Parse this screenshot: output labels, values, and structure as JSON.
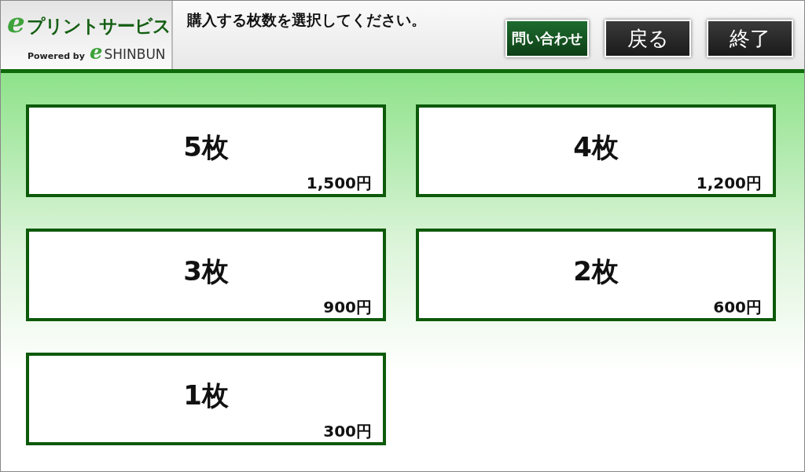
{
  "logo": {
    "mark": "e",
    "title": "プリントサービス",
    "powered_by": "Powered by",
    "brand_mark": "e",
    "brand": "SHINBUN"
  },
  "instruction": "購入する枚数を選択してください。",
  "header_buttons": [
    {
      "label": "問い合わせ",
      "kind": "contact"
    },
    {
      "label": "戻る",
      "kind": "nav"
    },
    {
      "label": "終了",
      "kind": "nav"
    }
  ],
  "options": [
    {
      "count": "5枚",
      "price": "1,500円"
    },
    {
      "count": "4枚",
      "price": "1,200円"
    },
    {
      "count": "3枚",
      "price": "900円"
    },
    {
      "count": "2枚",
      "price": "600円"
    },
    {
      "count": "1枚",
      "price": "300円"
    }
  ]
}
